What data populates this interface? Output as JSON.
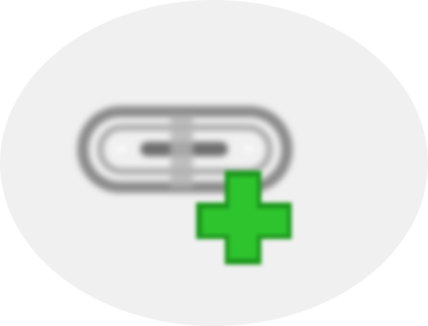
{
  "button": {
    "icon": "add-link-icon",
    "parts": [
      "link-chain-icon",
      "plus-icon"
    ],
    "colors": {
      "background": "#f0f0f0",
      "chain_stroke": "#8a8a8a",
      "chain_dark": "#6e6e6e",
      "plus_fill": "#2fc42f",
      "plus_border": "#1f9a1f"
    }
  }
}
